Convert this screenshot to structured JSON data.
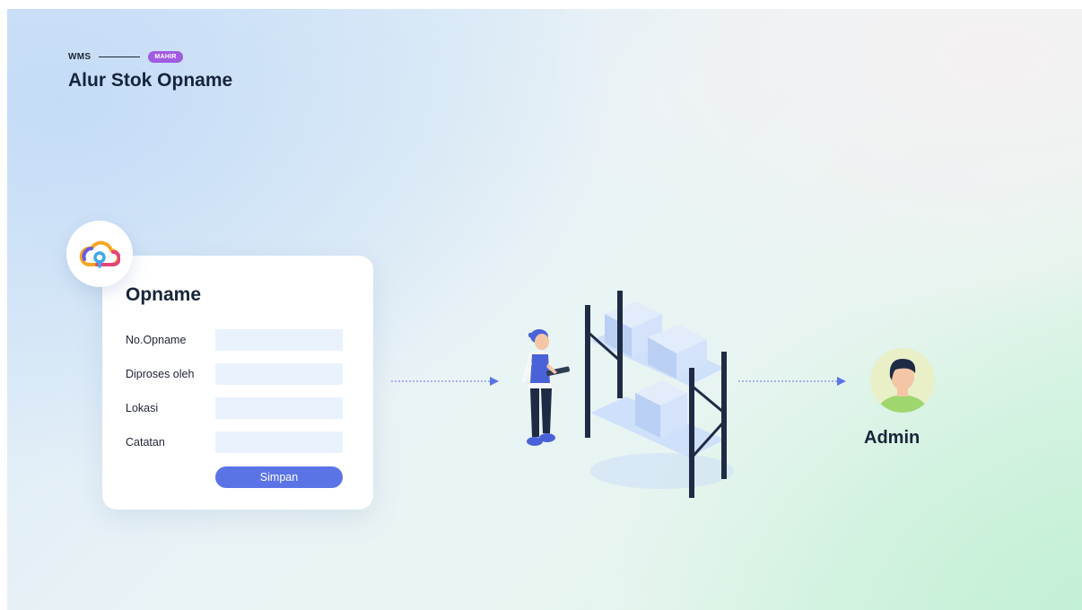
{
  "breadcrumb": {
    "system": "WMS",
    "level": "MAHIR"
  },
  "page": {
    "title": "Alur Stok Opname"
  },
  "form": {
    "title": "Opname",
    "fields": [
      {
        "label": "No.Opname",
        "value": ""
      },
      {
        "label": "Diproses oleh",
        "value": ""
      },
      {
        "label": "Lokasi",
        "value": ""
      },
      {
        "label": "Catatan",
        "value": ""
      }
    ],
    "save_label": "Simpan"
  },
  "flow": {
    "worker_icon": "warehouse-worker-icon",
    "shelf_icon": "storage-shelf-icon",
    "admin_label": "Admin"
  },
  "colors": {
    "accent": "#5a74e6",
    "badge": "#a25be0",
    "text": "#16253a",
    "input_bg": "#e9f2fc"
  }
}
